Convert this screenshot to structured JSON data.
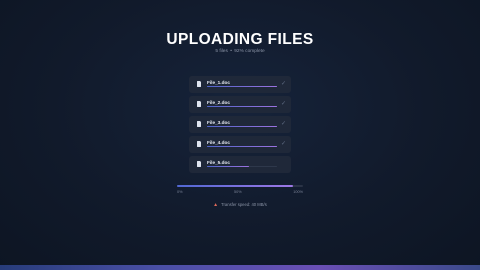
{
  "header": {
    "title": "UPLOADING FILES",
    "file_count": "5 files",
    "separator": "•",
    "complete": "92% complete"
  },
  "files": [
    {
      "name": "File_1.doc",
      "progress": 1.0,
      "status": "✓",
      "status_icon": "check-icon"
    },
    {
      "name": "File_2.doc",
      "progress": 1.0,
      "status": "✓",
      "status_icon": "check-icon"
    },
    {
      "name": "File_3.doc",
      "progress": 1.0,
      "status": "✓",
      "status_icon": "check-icon"
    },
    {
      "name": "File_4.doc",
      "progress": 1.0,
      "status": "✓",
      "status_icon": "check-icon"
    },
    {
      "name": "File_5.doc",
      "progress": 0.6,
      "status": "",
      "status_icon": ""
    }
  ],
  "overall": {
    "progress": 0.92,
    "tick_start": "0%",
    "tick_mid": "50%",
    "tick_end": "100%"
  },
  "speed": {
    "icon": "rocket-icon",
    "text": "Transfer speed: 40 MB/s"
  },
  "colors": {
    "accent_start": "#4f63c9",
    "accent_end": "#9b73e0",
    "background": "#111a2b"
  }
}
